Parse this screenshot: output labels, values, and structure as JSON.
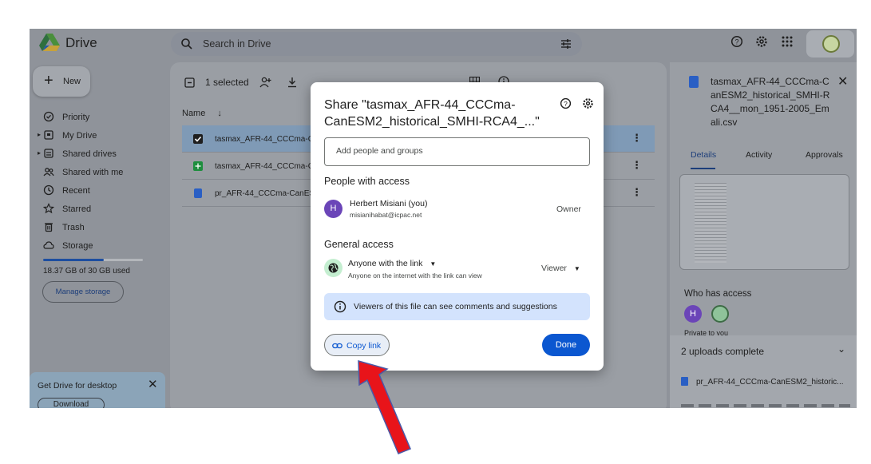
{
  "app": {
    "name": "Drive"
  },
  "search": {
    "placeholder": "Search in Drive"
  },
  "new_button": {
    "label": "New"
  },
  "nav": {
    "items": [
      {
        "label": "Priority",
        "icon": "priority-icon"
      },
      {
        "label": "My Drive",
        "icon": "my-drive-icon"
      },
      {
        "label": "Shared drives",
        "icon": "shared-drives-icon"
      },
      {
        "label": "Shared with me",
        "icon": "shared-with-me-icon"
      },
      {
        "label": "Recent",
        "icon": "clock-icon"
      },
      {
        "label": "Starred",
        "icon": "star-icon"
      },
      {
        "label": "Trash",
        "icon": "trash-icon"
      },
      {
        "label": "Storage",
        "icon": "cloud-icon"
      }
    ]
  },
  "storage": {
    "used_text": "18.37 GB of 30 GB used",
    "used_fraction": 0.61,
    "manage_label": "Manage storage"
  },
  "desktop_promo": {
    "title": "Get Drive for desktop",
    "download_label": "Download"
  },
  "toolbar": {
    "selected_text": "1 selected"
  },
  "file_list": {
    "column_name": "Name",
    "rows": [
      {
        "name": "tasmax_AFR-44_CCCma-C",
        "type": "checkbox"
      },
      {
        "name": "tasmax_AFR-44_CCCma-C",
        "type": "sheet"
      },
      {
        "name": "pr_AFR-44_CCCma-CanES",
        "type": "doc"
      }
    ]
  },
  "details": {
    "title": "tasmax_AFR-44_CCCma-CanESM2_historical_SMHI-RCA4__mon_1951-2005_Emali.csv",
    "tabs": [
      "Details",
      "Activity",
      "Approvals"
    ],
    "who_has_access": "Who has access",
    "avatar_initial": "H",
    "private_text": "Private to you"
  },
  "uploads": {
    "header": "2 uploads complete",
    "item": "pr_AFR-44_CCCma-CanESM2_historic..."
  },
  "dialog": {
    "title": "Share \"tasmax_AFR-44_CCCma-CanESM2_historical_SMHI-RCA4_...\"",
    "add_placeholder": "Add people and groups",
    "people_heading": "People with access",
    "person": {
      "initial": "H",
      "name": "Herbert Misiani (you)",
      "email": "misianihabat@icpac.net",
      "role": "Owner"
    },
    "general_heading": "General access",
    "access_level": "Anyone with the link",
    "access_desc": "Anyone on the internet with the link can view",
    "role": "Viewer",
    "info_text": "Viewers of this file can see comments and suggestions",
    "copy_link": "Copy link",
    "done": "Done"
  },
  "colors": {
    "accent": "#0b57d0",
    "arrow": "#e8141a",
    "avatar": "#6b45b8",
    "info_bg": "#d3e3fd"
  }
}
